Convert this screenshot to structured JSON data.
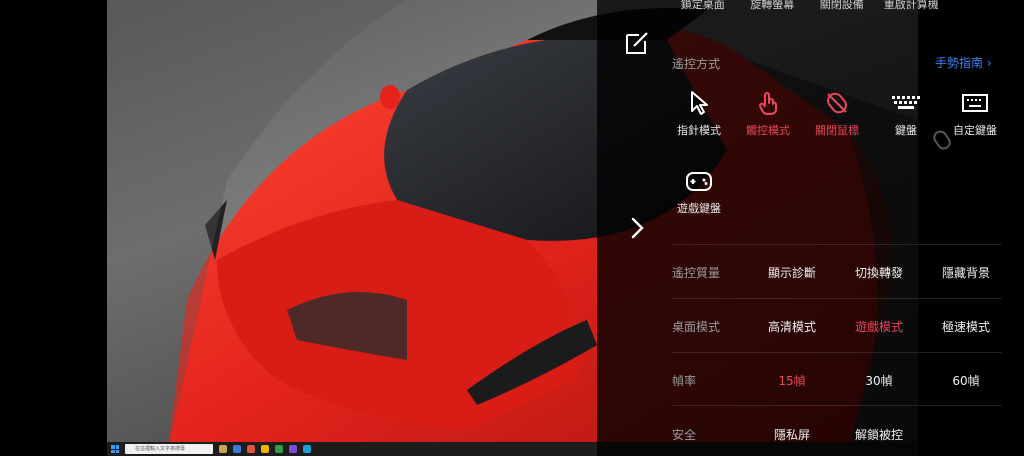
{
  "top_actions": [
    "鎖定桌面",
    "旋轉螢幕",
    "關閉設備",
    "重啟計算機"
  ],
  "control": {
    "label": "遙控方式",
    "guide_link": "手勢指南",
    "modes": [
      {
        "label": "指針模式",
        "icon": "pointer-icon",
        "active": false
      },
      {
        "label": "觸控模式",
        "icon": "touch-icon",
        "active": true
      },
      {
        "label": "關閉鼠標",
        "icon": "mouse-off-icon",
        "active": true
      },
      {
        "label": "鍵盤",
        "icon": "keyboard-icon",
        "active": false
      },
      {
        "label": "自定鍵盤",
        "icon": "custom-keyboard-icon",
        "active": false
      },
      {
        "label": "遊戲鍵盤",
        "icon": "gamepad-icon",
        "active": false
      }
    ]
  },
  "quality": {
    "label": "遙控質量",
    "options": [
      "顯示診斷",
      "切換轉發",
      "隱藏背景"
    ]
  },
  "desktop_mode": {
    "label": "桌面模式",
    "options": [
      "高清模式",
      "遊戲模式",
      "極速模式"
    ],
    "selected": "遊戲模式"
  },
  "frame_rate": {
    "label": "幀率",
    "options": [
      "15幀",
      "30幀",
      "60幀"
    ],
    "selected": "15幀"
  },
  "security": {
    "label": "安全",
    "options": [
      "隱私屏",
      "解鎖被控"
    ]
  },
  "taskbar": {
    "search_placeholder": "在這裡輸入文字來搜尋"
  },
  "colors": {
    "accent": "#e8465a",
    "link": "#3b82f6",
    "car_red": "#e8231e"
  }
}
